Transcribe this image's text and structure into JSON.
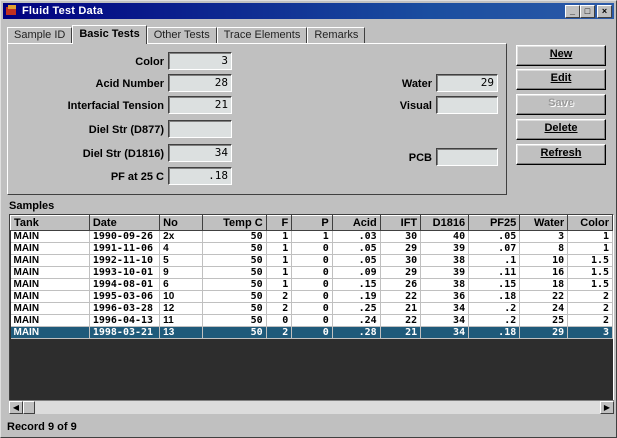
{
  "window": {
    "title": "Fluid Test Data",
    "min": "_",
    "max": "□",
    "close": "×"
  },
  "tabs": [
    {
      "label": "Sample ID"
    },
    {
      "label": "Basic Tests"
    },
    {
      "label": "Other Tests"
    },
    {
      "label": "Trace Elements"
    },
    {
      "label": "Remarks"
    }
  ],
  "fields": {
    "color": {
      "label": "Color",
      "value": "3"
    },
    "acid_number": {
      "label": "Acid Number",
      "value": "28"
    },
    "interfacial_tension": {
      "label": "Interfacial Tension",
      "value": "21"
    },
    "diel_d877": {
      "label": "Diel Str (D877)",
      "value": ""
    },
    "diel_d1816": {
      "label": "Diel Str (D1816)",
      "value": "34"
    },
    "pf25": {
      "label": "PF at 25 C",
      "value": ".18"
    },
    "water": {
      "label": "Water",
      "value": "29"
    },
    "visual": {
      "label": "Visual",
      "value": ""
    },
    "pcb": {
      "label": "PCB",
      "value": ""
    }
  },
  "buttons": {
    "new": "New",
    "edit": "Edit",
    "save": "Save",
    "delete": "Delete",
    "refresh": "Refresh"
  },
  "samples": {
    "label": "Samples",
    "columns": [
      "Tank",
      "Date",
      "No",
      "Temp C",
      "F",
      "P",
      "Acid",
      "IFT",
      "D1816",
      "PF25",
      "Water",
      "Color"
    ],
    "rows": [
      [
        "MAIN",
        "1990-09-26",
        "2x",
        "50",
        "1",
        "1",
        ".03",
        "30",
        "40",
        ".05",
        "3",
        "1"
      ],
      [
        "MAIN",
        "1991-11-06",
        "4",
        "50",
        "1",
        "0",
        ".05",
        "29",
        "39",
        ".07",
        "8",
        "1"
      ],
      [
        "MAIN",
        "1992-11-10",
        "5",
        "50",
        "1",
        "0",
        ".05",
        "30",
        "38",
        ".1",
        "10",
        "1.5"
      ],
      [
        "MAIN",
        "1993-10-01",
        "9",
        "50",
        "1",
        "0",
        ".09",
        "29",
        "39",
        ".11",
        "16",
        "1.5"
      ],
      [
        "MAIN",
        "1994-08-01",
        "6",
        "50",
        "1",
        "0",
        ".15",
        "26",
        "38",
        ".15",
        "18",
        "1.5"
      ],
      [
        "MAIN",
        "1995-03-06",
        "10",
        "50",
        "2",
        "0",
        ".19",
        "22",
        "36",
        ".18",
        "22",
        "2"
      ],
      [
        "MAIN",
        "1996-03-28",
        "12",
        "50",
        "2",
        "0",
        ".25",
        "21",
        "34",
        ".2",
        "24",
        "2"
      ],
      [
        "MAIN",
        "1996-04-13",
        "11",
        "50",
        "0",
        "0",
        ".24",
        "22",
        "34",
        ".2",
        "25",
        "2"
      ],
      [
        "MAIN",
        "1998-03-21",
        "13",
        "50",
        "2",
        "0",
        ".28",
        "21",
        "34",
        ".18",
        "29",
        "3"
      ]
    ],
    "selected_row": 8
  },
  "status": "Record 9 of 9",
  "colors": {
    "title_bar": "#000080",
    "selection": "#1f5a7a",
    "field_bg": "#dce0e0"
  }
}
